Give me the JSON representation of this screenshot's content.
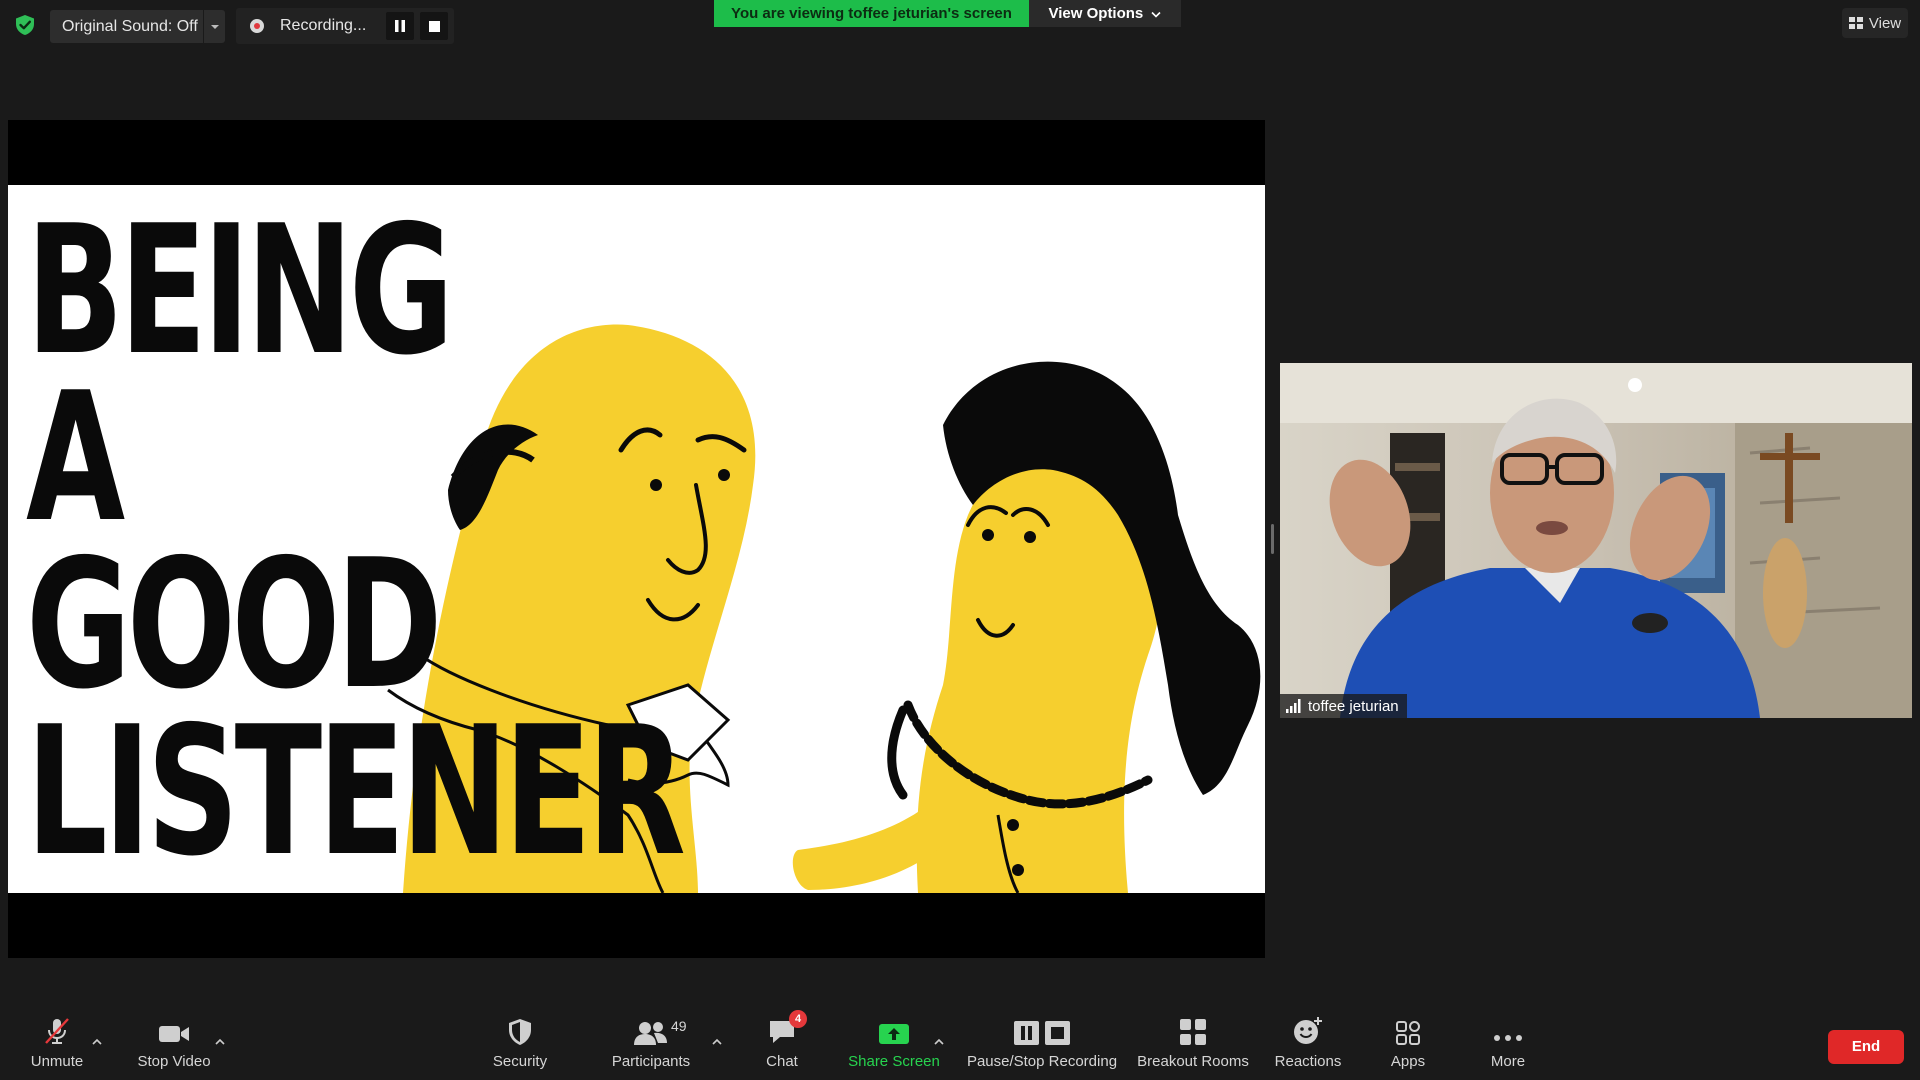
{
  "top_bar": {
    "original_sound_label": "Original Sound: Off",
    "recording_label": "Recording...",
    "viewing_banner": "You are viewing toffee jeturian's screen",
    "view_options_label": "View Options",
    "view_label": "View"
  },
  "slide": {
    "title_lines": [
      "BEING",
      "A",
      "GOOD",
      "LISTENER"
    ]
  },
  "participant": {
    "name": "toffee jeturian"
  },
  "toolbar": {
    "unmute": "Unmute",
    "stop_video": "Stop Video",
    "security": "Security",
    "participants": "Participants",
    "participants_count": "49",
    "chat": "Chat",
    "chat_badge": "4",
    "share_screen": "Share Screen",
    "pause_stop_recording": "Pause/Stop Recording",
    "breakout_rooms": "Breakout Rooms",
    "reactions": "Reactions",
    "apps": "Apps",
    "more": "More",
    "end": "End"
  },
  "colors": {
    "background": "#1a1a1a",
    "banner_green": "#1dbd4a",
    "share_green": "#27d34f",
    "end_red": "#e02828",
    "slide_yellow": "#f6cf2e"
  }
}
